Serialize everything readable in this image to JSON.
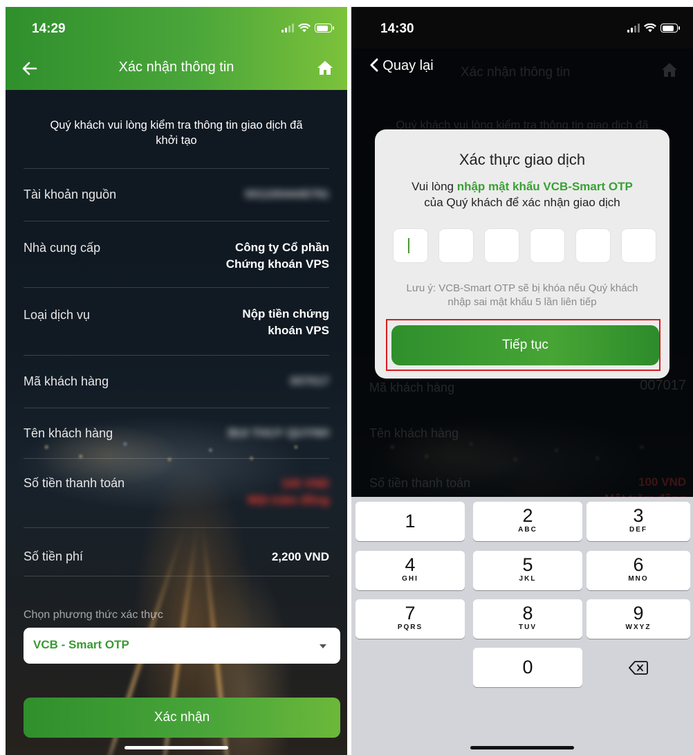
{
  "left": {
    "status_time": "14:29",
    "nav_title": "Xác nhận thông tin",
    "intro_text": "Quý khách vui lòng kiểm tra thông tin giao dịch đã khởi tạo",
    "rows": [
      {
        "label": "Tài khoản nguồn",
        "value": "0011004445791"
      },
      {
        "label": "Nhà cung cấp",
        "value_line1": "Công ty Cổ phần",
        "value_line2": "Chứng khoán VPS"
      },
      {
        "label": "Loại dịch vụ",
        "value_line1": "Nộp tiền chứng",
        "value_line2": "khoán VPS"
      },
      {
        "label": "Mã khách hàng",
        "value": "007017"
      },
      {
        "label": "Tên khách hàng",
        "value": "BUI THUY QUYNH"
      },
      {
        "label": "Số tiền thanh toán",
        "value_line1": "100 VND",
        "value_line2": "Một trăm đồng"
      },
      {
        "label": "Số tiền phí",
        "value": "2,200 VND"
      }
    ],
    "auth_method_label": "Chọn phương thức xác thực",
    "auth_method_value": "VCB - Smart OTP",
    "confirm_button": "Xác nhận"
  },
  "right": {
    "status_time": "14:30",
    "back_label": "Quay lại",
    "nav_title": "Xác nhận thông tin",
    "background": {
      "intro_text": "Quý khách vui lòng kiểm tra thông tin giao dịch đã khởi tạo",
      "customer_code_label": "Mã khách hàng",
      "customer_code_value": "007017",
      "customer_name_label": "Tên khách hàng",
      "payment_label": "Số tiền thanh toán",
      "payment_value": "100 VND",
      "payment_words": "Một trăm đồng"
    },
    "modal": {
      "title": "Xác thực giao dịch",
      "desc_prefix": "Vui lòng ",
      "desc_highlight": "nhập mật khẩu VCB-Smart OTP",
      "desc_suffix": "của Quý khách để xác nhận giao dịch",
      "otp_digits": 6,
      "note": "Lưu ý: VCB-Smart OTP sẽ bị khóa nếu Quý khách nhập sai mật khẩu 5 lần liên tiếp",
      "continue_button": "Tiếp tục",
      "highlight_color": "#d81d1d"
    },
    "keypad": {
      "keys": [
        {
          "num": "1",
          "sub": ""
        },
        {
          "num": "2",
          "sub": "ABC"
        },
        {
          "num": "3",
          "sub": "DEF"
        },
        {
          "num": "4",
          "sub": "GHI"
        },
        {
          "num": "5",
          "sub": "JKL"
        },
        {
          "num": "6",
          "sub": "MNO"
        },
        {
          "num": "7",
          "sub": "PQRS"
        },
        {
          "num": "8",
          "sub": "TUV"
        },
        {
          "num": "9",
          "sub": "WXYZ"
        },
        {
          "num": "0",
          "sub": ""
        }
      ],
      "delete_icon": "backspace-icon"
    }
  },
  "colors": {
    "brand_green": "#3a9a33",
    "header_green_end": "#7cc23b",
    "amount_red": "#ff3b30"
  }
}
